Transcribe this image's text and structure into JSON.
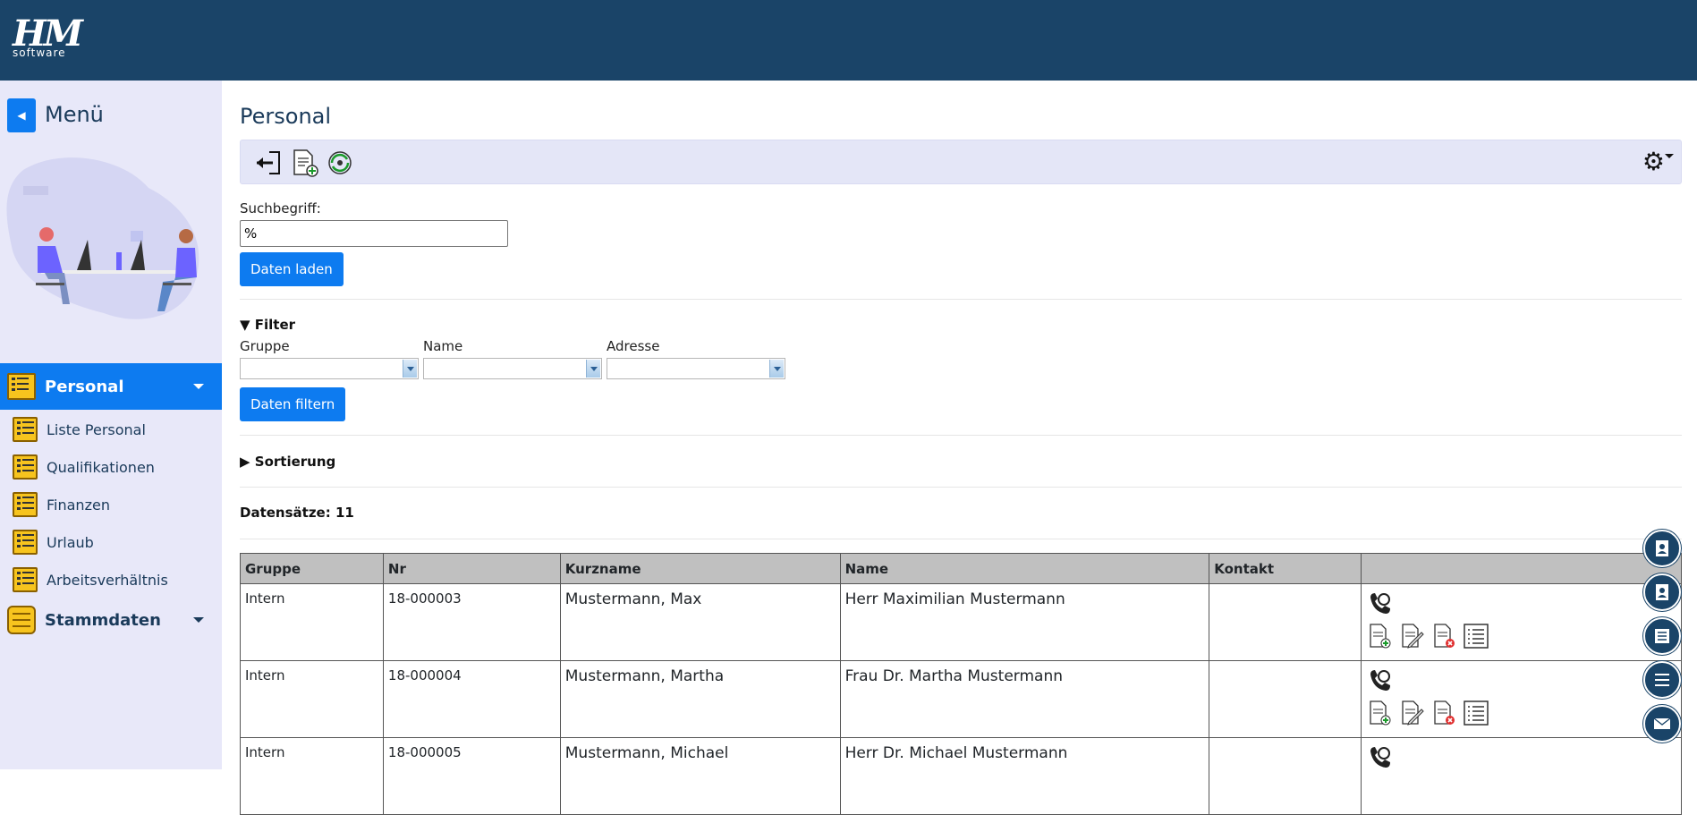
{
  "app": {
    "logo_text": "HM",
    "logo_sub": "software"
  },
  "sidebar": {
    "menu_title": "Menü",
    "active_item": "Personal",
    "sub_items": [
      "Liste Personal",
      "Qualifikationen",
      "Finanzen",
      "Urlaub",
      "Arbeitsverhältnis"
    ],
    "second_group": "Stammdaten"
  },
  "main": {
    "page_title": "Personal",
    "search_label": "Suchbegriff:",
    "search_value": "%",
    "load_button": "Daten laden",
    "filter_title": "Filter",
    "filter_labels": [
      "Gruppe",
      "Name",
      "Adresse"
    ],
    "filter_button": "Daten filtern",
    "sort_title": "Sortierung",
    "count_text": "Datensätze: 11"
  },
  "table": {
    "headers": [
      "Gruppe",
      "Nr",
      "Kurzname",
      "Name",
      "Kontakt",
      ""
    ],
    "rows": [
      {
        "gruppe": "Intern",
        "nr": "18-000003",
        "kurzname": "Mustermann, Max",
        "name": "Herr Maximilian Mustermann",
        "kontakt": ""
      },
      {
        "gruppe": "Intern",
        "nr": "18-000004",
        "kurzname": "Mustermann, Martha",
        "name": "Frau Dr. Martha Mustermann",
        "kontakt": ""
      },
      {
        "gruppe": "Intern",
        "nr": "18-000005",
        "kurzname": "Mustermann, Michael",
        "name": "Herr Dr. Michael Mustermann",
        "kontakt": ""
      }
    ]
  },
  "icons": {
    "toolbar": [
      "back-arrow-icon",
      "new-document-icon",
      "refresh-icon"
    ],
    "settings": "gear-icon",
    "row_actions": [
      "contact-phone-icon",
      "add-document-icon",
      "edit-document-icon",
      "delete-document-icon",
      "details-list-icon"
    ],
    "floating": [
      "contact-card-icon",
      "contact-card-icon",
      "list-icon",
      "hamburger-menu-icon",
      "mail-icon"
    ]
  },
  "colors": {
    "header": "#1a4468",
    "sidebar": "#e8e8f9",
    "primary": "#0d7bf0",
    "toolbar": "#e4e6f7",
    "table_header": "#c0c0c0"
  }
}
